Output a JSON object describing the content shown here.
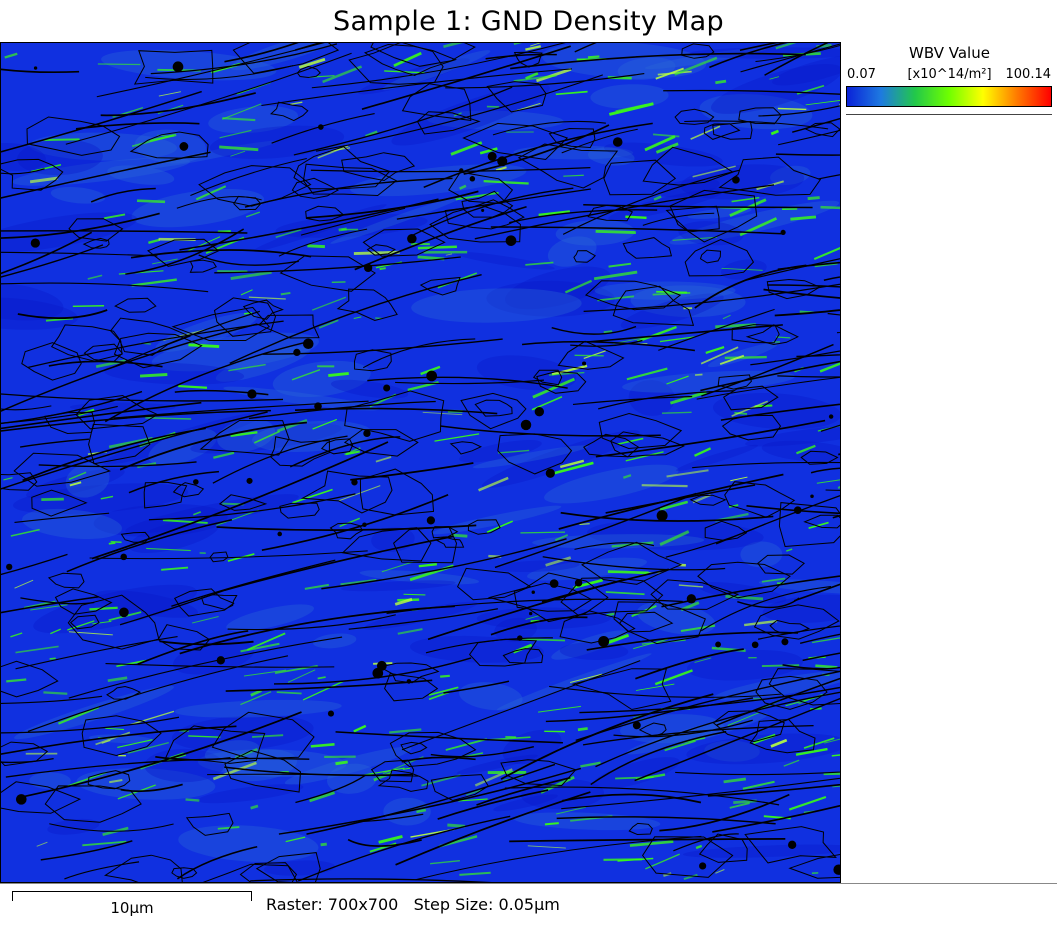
{
  "title": "Sample 1: GND Density Map",
  "legend": {
    "title": "WBV Value",
    "min": "0.07",
    "unit": "[x10^14/m²]",
    "max": "100.14",
    "colors": [
      "#0a22d8",
      "#1e7ae0",
      "#22c84a",
      "#6fff00",
      "#ffff00",
      "#ff7a00",
      "#ff0000"
    ]
  },
  "footer": {
    "scale_label": "10µm",
    "raster": "Raster: 700x700",
    "step_size": "Step Size: 0.05µm"
  },
  "map": {
    "background": "#1030e0",
    "boundary_color": "#000000",
    "highlight_color": "#39ff14"
  }
}
